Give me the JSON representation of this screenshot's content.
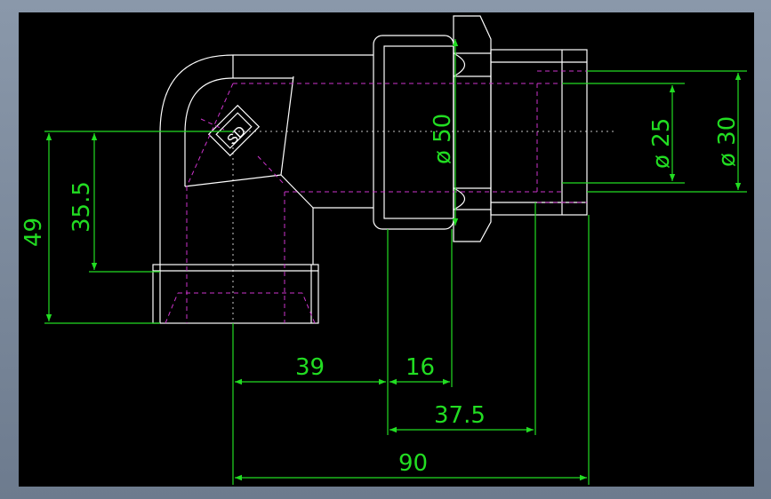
{
  "dimensions": {
    "d39": "39",
    "d16": "16",
    "d37_5": "37.5",
    "d90": "90",
    "d49": "49",
    "d35_5": "35.5",
    "dia50": "ø 50",
    "dia25": "ø 25",
    "dia30": "ø 30"
  },
  "colors": {
    "background": "#000000",
    "outline": "#ffffff",
    "dimension": "#22dd22",
    "hidden": "#cc33cc",
    "frame": "#7a889a"
  }
}
